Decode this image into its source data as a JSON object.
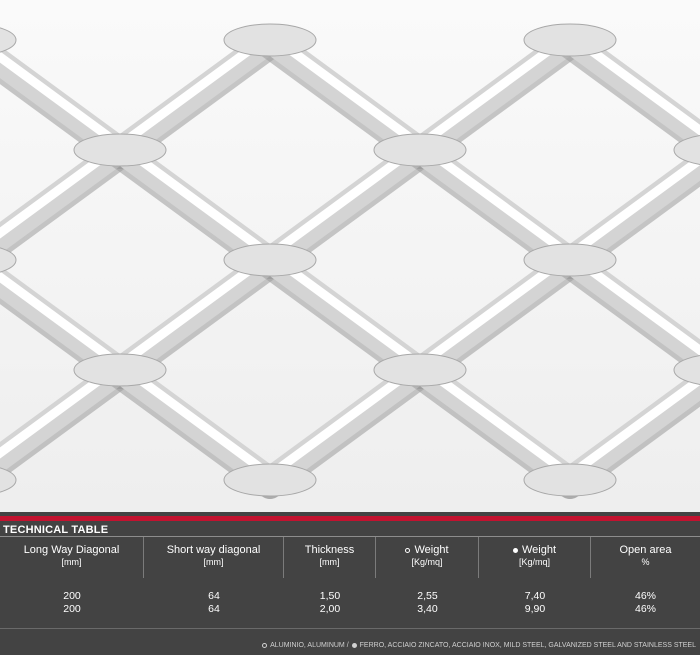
{
  "photo": {
    "subject": "expanded-metal-mesh"
  },
  "table": {
    "title": "TECHNICAL TABLE",
    "columns": [
      {
        "label": "Long Way Diagonal",
        "unit": "[mm]"
      },
      {
        "label": "Short way diagonal",
        "unit": "[mm]"
      },
      {
        "label": "Thickness",
        "unit": "[mm]"
      },
      {
        "label": "Weight",
        "unit": "[Kg/mq]",
        "marker": "open-circle-icon"
      },
      {
        "label": "Weight",
        "unit": "[Kg/mq]",
        "marker": "filled-circle-icon"
      },
      {
        "label": "Open area",
        "unit": "%"
      }
    ],
    "rows": [
      [
        "200",
        "64",
        "1,50",
        "2,55",
        "7,40",
        "46%"
      ],
      [
        "200",
        "64",
        "2,00",
        "3,40",
        "9,90",
        "46%"
      ]
    ]
  },
  "legend": {
    "aluminium": "ALUMINIO, ALUMINUM /",
    "steel": "FERRO, ACCIAIO ZINCATO, ACCIAIO INOX, MILD STEEL, GALVANIZED STEEL AND STAINLESS STEEL"
  },
  "colors": {
    "panel": "#434343",
    "accent": "#c3122f",
    "text": "#ffffff"
  }
}
